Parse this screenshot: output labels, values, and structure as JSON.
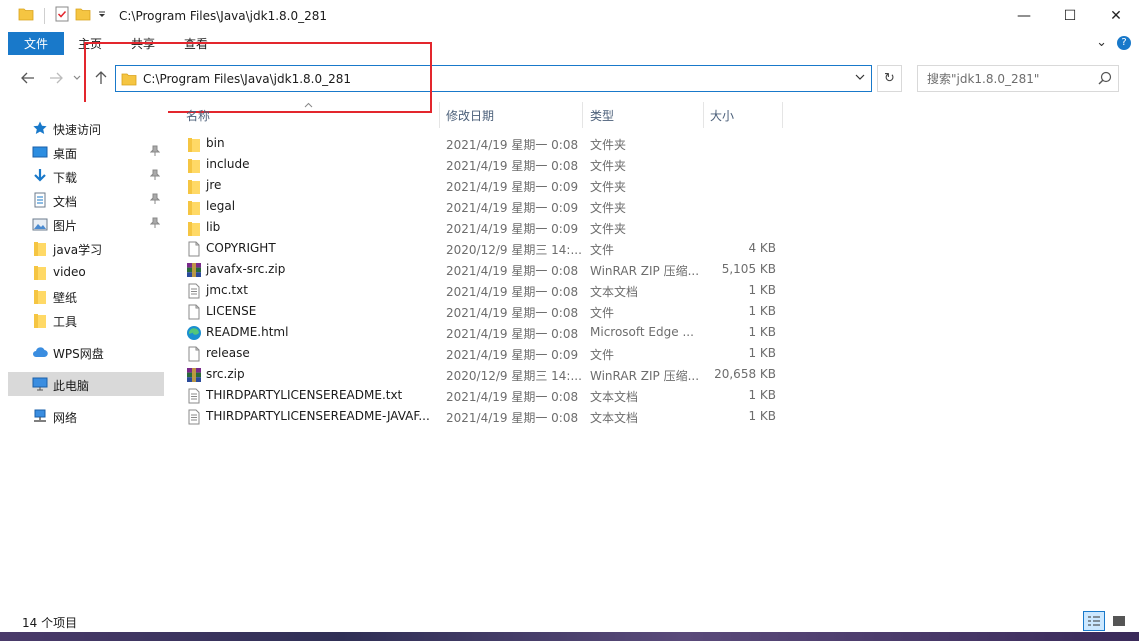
{
  "window": {
    "title": "C:\\Program Files\\Java\\jdk1.8.0_281",
    "minimize": "—",
    "maximize": "☐",
    "close": "✕"
  },
  "ribbon": {
    "tabs": [
      "文件",
      "主页",
      "共享",
      "查看"
    ],
    "expand_glyph": "⌄",
    "help_glyph": "?"
  },
  "address": {
    "path": "C:\\Program Files\\Java\\jdk1.8.0_281"
  },
  "search": {
    "placeholder": "搜索\"jdk1.8.0_281\""
  },
  "sidebar": {
    "items": [
      {
        "label": "快速访问",
        "icon": "star-icon"
      },
      {
        "label": "桌面",
        "icon": "desktop-icon",
        "pinned": true
      },
      {
        "label": "下载",
        "icon": "download-icon",
        "pinned": true
      },
      {
        "label": "文档",
        "icon": "document-icon",
        "pinned": true
      },
      {
        "label": "图片",
        "icon": "pictures-icon",
        "pinned": true
      },
      {
        "label": "java学习",
        "icon": "folder-icon"
      },
      {
        "label": "video",
        "icon": "folder-icon"
      },
      {
        "label": "壁纸",
        "icon": "folder-icon"
      },
      {
        "label": "工具",
        "icon": "folder-icon"
      },
      {
        "label": "WPS网盘",
        "icon": "cloud-icon"
      },
      {
        "label": "此电脑",
        "icon": "computer-icon",
        "selected": true
      },
      {
        "label": "网络",
        "icon": "network-icon"
      }
    ]
  },
  "columns": {
    "name": "名称",
    "date": "修改日期",
    "type": "类型",
    "size": "大小"
  },
  "files": [
    {
      "name": "bin",
      "date": "2021/4/19 星期一 0:08",
      "type": "文件夹",
      "size": "",
      "icon": "folder-icon"
    },
    {
      "name": "include",
      "date": "2021/4/19 星期一 0:08",
      "type": "文件夹",
      "size": "",
      "icon": "folder-icon"
    },
    {
      "name": "jre",
      "date": "2021/4/19 星期一 0:09",
      "type": "文件夹",
      "size": "",
      "icon": "folder-icon"
    },
    {
      "name": "legal",
      "date": "2021/4/19 星期一 0:09",
      "type": "文件夹",
      "size": "",
      "icon": "folder-icon"
    },
    {
      "name": "lib",
      "date": "2021/4/19 星期一 0:09",
      "type": "文件夹",
      "size": "",
      "icon": "folder-icon"
    },
    {
      "name": "COPYRIGHT",
      "date": "2020/12/9 星期三 14:...",
      "type": "文件",
      "size": "4 KB",
      "icon": "file-icon"
    },
    {
      "name": "javafx-src.zip",
      "date": "2021/4/19 星期一 0:08",
      "type": "WinRAR ZIP 压缩...",
      "size": "5,105 KB",
      "icon": "winrar-icon"
    },
    {
      "name": "jmc.txt",
      "date": "2021/4/19 星期一 0:08",
      "type": "文本文档",
      "size": "1 KB",
      "icon": "text-file-icon"
    },
    {
      "name": "LICENSE",
      "date": "2021/4/19 星期一 0:08",
      "type": "文件",
      "size": "1 KB",
      "icon": "file-icon"
    },
    {
      "name": "README.html",
      "date": "2021/4/19 星期一 0:08",
      "type": "Microsoft Edge ...",
      "size": "1 KB",
      "icon": "edge-icon"
    },
    {
      "name": "release",
      "date": "2021/4/19 星期一 0:09",
      "type": "文件",
      "size": "1 KB",
      "icon": "file-icon"
    },
    {
      "name": "src.zip",
      "date": "2020/12/9 星期三 14:...",
      "type": "WinRAR ZIP 压缩...",
      "size": "20,658 KB",
      "icon": "winrar-icon"
    },
    {
      "name": "THIRDPARTYLICENSEREADME.txt",
      "date": "2021/4/19 星期一 0:08",
      "type": "文本文档",
      "size": "1 KB",
      "icon": "text-file-icon"
    },
    {
      "name": "THIRDPARTYLICENSEREADME-JAVAF...",
      "date": "2021/4/19 星期一 0:08",
      "type": "文本文档",
      "size": "1 KB",
      "icon": "text-file-icon"
    }
  ],
  "status": {
    "item_count": "14 个项目"
  },
  "colors": {
    "accent": "#1979ca",
    "highlight_box": "#e3262d",
    "folder": "#f5c542",
    "selected_bg": "#d9d9d9"
  }
}
